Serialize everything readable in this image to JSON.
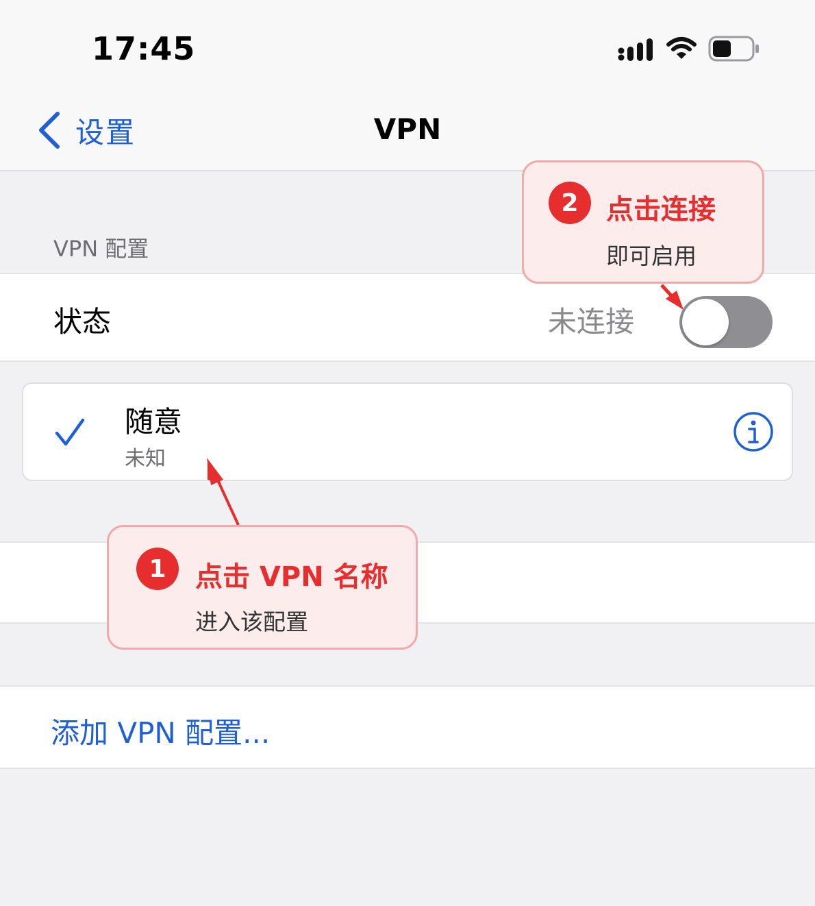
{
  "status_bar": {
    "time": "17:45",
    "icons": [
      "signal-icon",
      "wifi-icon",
      "battery-icon"
    ]
  },
  "nav": {
    "back_label": "设置",
    "title": "VPN"
  },
  "section": {
    "header": "VPN 配置"
  },
  "status_row": {
    "label": "状态",
    "value": "未连接",
    "toggle_on": false
  },
  "vpn_item": {
    "name": "随意",
    "subtitle": "未知",
    "selected": true
  },
  "add_config": {
    "label": "添加 VPN 配置..."
  },
  "callouts": [
    {
      "number": "1",
      "title": "点击 VPN 名称",
      "subtitle": "进入该配置"
    },
    {
      "number": "2",
      "title": "点击连接",
      "subtitle": "即可启用"
    }
  ],
  "colors": {
    "accent": "#1f5fd6",
    "annotation_red": "#e62e2e",
    "annotation_bg": "#fdecec",
    "toggle_off": "#8e8e93"
  }
}
